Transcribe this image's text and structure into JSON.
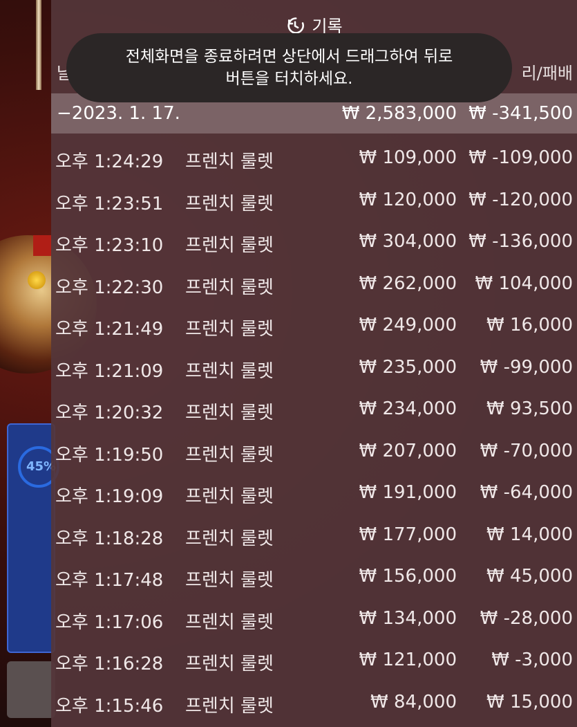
{
  "header": {
    "icon": "history-icon",
    "title": "기록"
  },
  "toast": {
    "line1": "전체화면을 종료하려면 상단에서 드래그하여 뒤로",
    "line2": "버튼을 터치하세요."
  },
  "columns": {
    "left_partial": "날",
    "right_partial": "리/패배"
  },
  "background": {
    "progress_text": "45%"
  },
  "summary": {
    "date": "−2023. 1. 17.",
    "bet": "₩ 2,583,000",
    "winloss": "₩ -341,500"
  },
  "rows": [
    {
      "time": "오후 1:24:29",
      "game": "프렌치 룰렛",
      "bet": "₩ 109,000",
      "winloss": "₩ -109,000"
    },
    {
      "time": "오후 1:23:51",
      "game": "프렌치 룰렛",
      "bet": "₩ 120,000",
      "winloss": "₩ -120,000"
    },
    {
      "time": "오후 1:23:10",
      "game": "프렌치 룰렛",
      "bet": "₩ 304,000",
      "winloss": "₩ -136,000"
    },
    {
      "time": "오후 1:22:30",
      "game": "프렌치 룰렛",
      "bet": "₩ 262,000",
      "winloss": "₩ 104,000"
    },
    {
      "time": "오후 1:21:49",
      "game": "프렌치 룰렛",
      "bet": "₩ 249,000",
      "winloss": "₩ 16,000"
    },
    {
      "time": "오후 1:21:09",
      "game": "프렌치 룰렛",
      "bet": "₩ 235,000",
      "winloss": "₩ -99,000"
    },
    {
      "time": "오후 1:20:32",
      "game": "프렌치 룰렛",
      "bet": "₩ 234,000",
      "winloss": "₩ 93,500"
    },
    {
      "time": "오후 1:19:50",
      "game": "프렌치 룰렛",
      "bet": "₩ 207,000",
      "winloss": "₩ -70,000"
    },
    {
      "time": "오후 1:19:09",
      "game": "프렌치 룰렛",
      "bet": "₩ 191,000",
      "winloss": "₩ -64,000"
    },
    {
      "time": "오후 1:18:28",
      "game": "프렌치 룰렛",
      "bet": "₩ 177,000",
      "winloss": "₩ 14,000"
    },
    {
      "time": "오후 1:17:48",
      "game": "프렌치 룰렛",
      "bet": "₩ 156,000",
      "winloss": "₩ 45,000"
    },
    {
      "time": "오후 1:17:06",
      "game": "프렌치 룰렛",
      "bet": "₩ 134,000",
      "winloss": "₩ -28,000"
    },
    {
      "time": "오후 1:16:28",
      "game": "프렌치 룰렛",
      "bet": "₩ 121,000",
      "winloss": "₩ -3,000"
    },
    {
      "time": "오후 1:15:46",
      "game": "프렌치 룰렛",
      "bet": "₩ 84,000",
      "winloss": "₩ 15,000"
    }
  ]
}
